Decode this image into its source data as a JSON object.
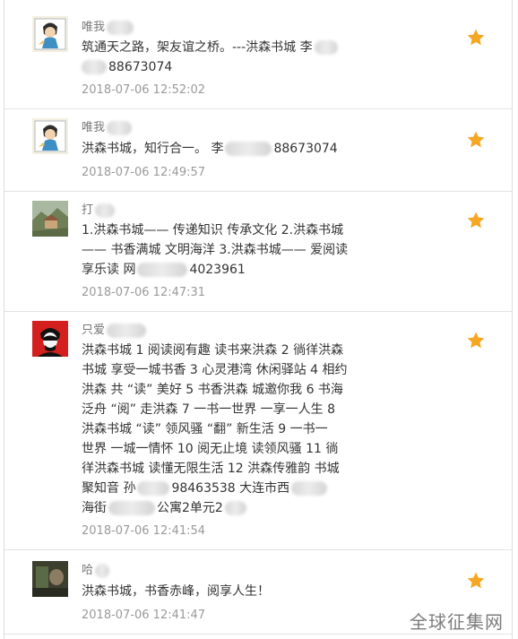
{
  "colors": {
    "star": "#f5a623",
    "time": "#9a9a9a",
    "text": "#333333",
    "username": "#777777"
  },
  "comments": [
    {
      "username": "唯我",
      "lines": [
        "筑通天之路，架友谊之桥。---洪森书城 李",
        "88673074"
      ],
      "time": "2018-07-06 12:52:02",
      "icon": "star-icon"
    },
    {
      "username": "唯我",
      "lines": [
        "洪森书城，知行合一。 李",
        "88673074"
      ],
      "time": "2018-07-06 12:49:57",
      "icon": "star-icon"
    },
    {
      "username": "打",
      "lines": [
        "1.洪森书城—— 传递知识 传承文化 2.洪森书城",
        "—— 书香满城 文明海洋 3.洪森书城—— 爱阅读",
        "享乐读 网",
        "4023961"
      ],
      "time": "2018-07-06 12:47:31",
      "icon": "star-icon"
    },
    {
      "username": "只爱",
      "lines": [
        "洪森书城 1 阅读阅有趣 读书来洪森 2 徜徉洪森",
        "书城 享受一城书香 3 心灵港湾 休闲驿站 4 相约",
        "洪森 共 “读” 美好 5 书香洪森 城邀你我 6 书海",
        "泛舟 “阅” 走洪森 7 一书一世界 一享一人生 8",
        "洪森书城 “读” 领风骚 “翻” 新生活 9 一书一",
        "世界 一城一情怀 10 阅无止境 读领风骚 11 徜",
        "徉洪森书城 读懂无限生活 12 洪森传雅韵 书城",
        "聚知音 孙",
        "98463538 大连市西",
        "海街",
        "公寓2单元2"
      ],
      "time": "2018-07-06 12:41:54",
      "icon": "star-icon"
    },
    {
      "username": "哈",
      "lines": [
        "洪森书城，书香赤峰，阅享人生！"
      ],
      "time": "2018-07-06 12:41:47",
      "icon": "star-icon"
    }
  ],
  "watermark": "全球征集网"
}
